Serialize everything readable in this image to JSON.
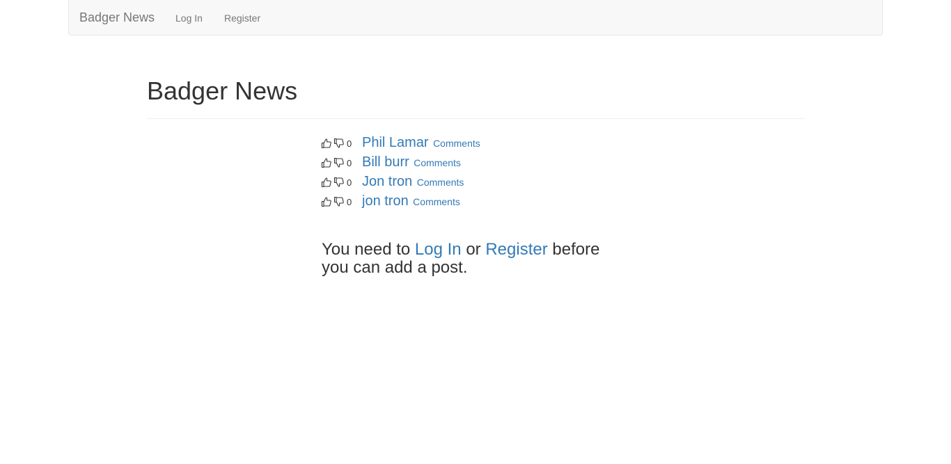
{
  "navbar": {
    "brand": "Badger News",
    "login_label": "Log In",
    "register_label": "Register"
  },
  "header": {
    "title": "Badger News"
  },
  "posts": [
    {
      "score": "0",
      "title": "Phil Lamar",
      "comments_label": "Comments"
    },
    {
      "score": "0",
      "title": "Bill burr",
      "comments_label": "Comments"
    },
    {
      "score": "0",
      "title": "Jon tron",
      "comments_label": "Comments"
    },
    {
      "score": "0",
      "title": "jon tron",
      "comments_label": "Comments"
    }
  ],
  "notice": {
    "prefix": "You need to",
    "login_label": "Log In",
    "middle": "or",
    "register_label": "Register",
    "suffix": "before you can add a post."
  },
  "icons": {
    "upvote": "thumbs-up-icon",
    "downvote": "thumbs-down-icon"
  },
  "colors": {
    "link": "#337ab7",
    "navbar_bg": "#f8f8f8",
    "navbar_text": "#777777",
    "text": "#333333"
  }
}
